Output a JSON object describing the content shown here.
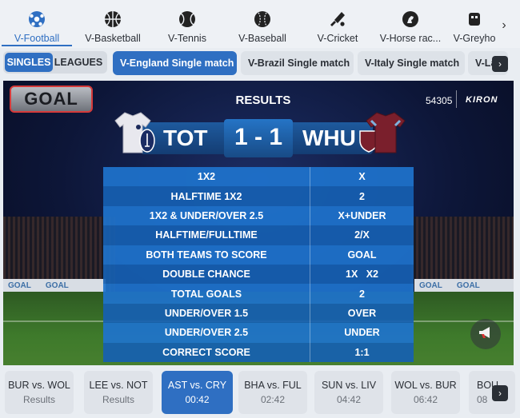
{
  "sport_tabs": [
    {
      "label": "V-Football",
      "icon": "soccer-ball-icon",
      "active": true
    },
    {
      "label": "V-Basketball",
      "icon": "basketball-icon",
      "active": false
    },
    {
      "label": "V-Tennis",
      "icon": "tennis-ball-icon",
      "active": false
    },
    {
      "label": "V-Baseball",
      "icon": "baseball-icon",
      "active": false
    },
    {
      "label": "V-Cricket",
      "icon": "cricket-bat-icon",
      "active": false
    },
    {
      "label": "V-Horse rac...",
      "icon": "horse-icon",
      "active": false
    },
    {
      "label": "V-Greyho",
      "icon": "greyhound-icon",
      "active": false
    }
  ],
  "mode_toggle": {
    "singles": "SINGLES",
    "leagues": "LEAGUES",
    "selected": "SINGLES"
  },
  "competitions": [
    {
      "label": "V-England Single match",
      "active": true
    },
    {
      "label": "V-Brazil Single match",
      "active": false
    },
    {
      "label": "V-Italy Single match",
      "active": false
    },
    {
      "label": "V-La",
      "active": false
    }
  ],
  "panel": {
    "logo_text": "GOAL",
    "title": "RESULTS",
    "event_id": "54305",
    "brand": "KIRON",
    "board_text": "GOAL",
    "home_team": "TOT",
    "away_team": "WHU",
    "score": "1 - 1",
    "results": [
      {
        "market": "1X2",
        "outcome": "X"
      },
      {
        "market": "HALFTIME 1X2",
        "outcome": "2"
      },
      {
        "market": "1X2 & UNDER/OVER 2.5",
        "outcome": "X+UNDER"
      },
      {
        "market": "HALFTIME/FULLTIME",
        "outcome": "2/X"
      },
      {
        "market": "BOTH TEAMS TO SCORE",
        "outcome": "GOAL"
      },
      {
        "market": "DOUBLE CHANCE",
        "outcome": "1X   X2"
      },
      {
        "market": "TOTAL GOALS",
        "outcome": "2"
      },
      {
        "market": "UNDER/OVER 1.5",
        "outcome": "OVER"
      },
      {
        "market": "UNDER/OVER 2.5",
        "outcome": "UNDER"
      },
      {
        "market": "CORRECT SCORE",
        "outcome": "1:1"
      }
    ]
  },
  "matches": [
    {
      "name": "BUR vs. WOL",
      "status": "Results",
      "active": false
    },
    {
      "name": "LEE vs. NOT",
      "status": "Results",
      "active": false
    },
    {
      "name": "AST vs. CRY",
      "status": "00:42",
      "active": true
    },
    {
      "name": "BHA vs. FUL",
      "status": "02:42",
      "active": false
    },
    {
      "name": "SUN vs. LIV",
      "status": "04:42",
      "active": false
    },
    {
      "name": "WOL vs. BUR",
      "status": "06:42",
      "active": false
    },
    {
      "name": "BOU",
      "status": "08",
      "active": false
    }
  ],
  "colors": {
    "accent": "#2f6fc2",
    "table_row": "#1e73cd",
    "home_shirt": "#e8e8ee",
    "away_shirt": "#7a1f2c"
  }
}
